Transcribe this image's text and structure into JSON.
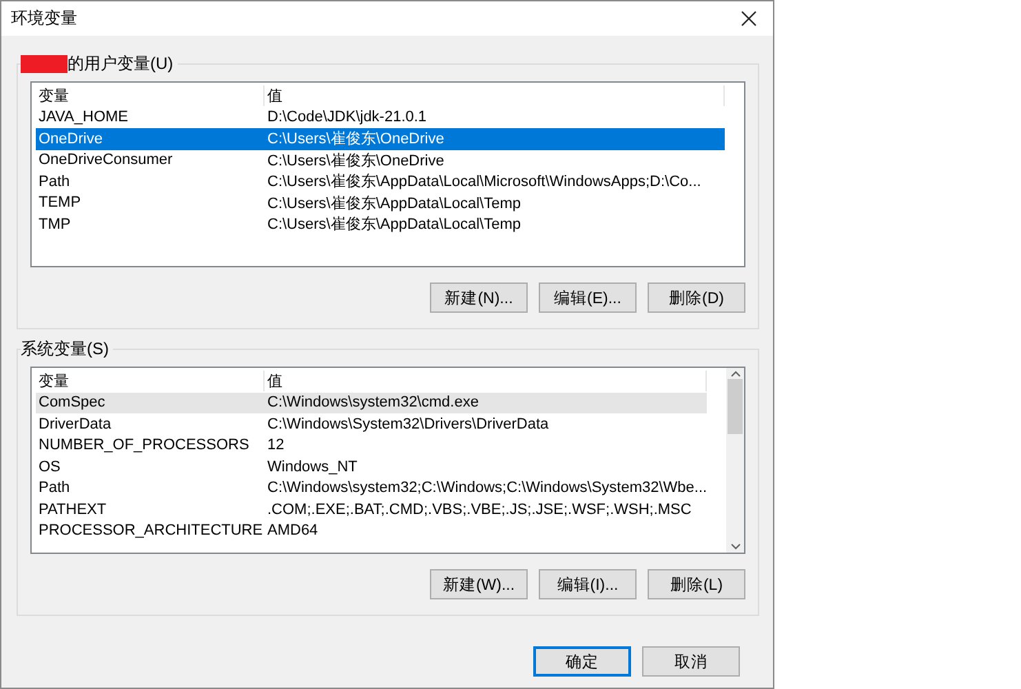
{
  "window": {
    "title": "环境变量"
  },
  "user_vars": {
    "legend": "的用户变量(U)",
    "focused": true,
    "columns": [
      "变量",
      "值"
    ],
    "rows": [
      {
        "name": "JAVA_HOME",
        "value": "D:\\Code\\JDK\\jdk-21.0.1",
        "selected": false
      },
      {
        "name": "OneDrive",
        "value": "C:\\Users\\崔俊东\\OneDrive",
        "selected": true
      },
      {
        "name": "OneDriveConsumer",
        "value": "C:\\Users\\崔俊东\\OneDrive",
        "selected": false
      },
      {
        "name": "Path",
        "value": "C:\\Users\\崔俊东\\AppData\\Local\\Microsoft\\WindowsApps;D:\\Co...",
        "selected": false
      },
      {
        "name": "TEMP",
        "value": "C:\\Users\\崔俊东\\AppData\\Local\\Temp",
        "selected": false
      },
      {
        "name": "TMP",
        "value": "C:\\Users\\崔俊东\\AppData\\Local\\Temp",
        "selected": false
      }
    ],
    "buttons": [
      "新建(N)...",
      "编辑(E)...",
      "删除(D)"
    ]
  },
  "system_vars": {
    "legend": "系统变量(S)",
    "focused": false,
    "columns": [
      "变量",
      "值"
    ],
    "rows": [
      {
        "name": "ComSpec",
        "value": "C:\\Windows\\system32\\cmd.exe",
        "selected": true
      },
      {
        "name": "DriverData",
        "value": "C:\\Windows\\System32\\Drivers\\DriverData",
        "selected": false
      },
      {
        "name": "NUMBER_OF_PROCESSORS",
        "value": "12",
        "selected": false
      },
      {
        "name": "OS",
        "value": "Windows_NT",
        "selected": false
      },
      {
        "name": "Path",
        "value": "C:\\Windows\\system32;C:\\Windows;C:\\Windows\\System32\\Wbe...",
        "selected": false
      },
      {
        "name": "PATHEXT",
        "value": ".COM;.EXE;.BAT;.CMD;.VBS;.VBE;.JS;.JSE;.WSF;.WSH;.MSC",
        "selected": false
      },
      {
        "name": "PROCESSOR_ARCHITECTURE",
        "value": "AMD64",
        "selected": false
      }
    ],
    "buttons": [
      "新建(W)...",
      "编辑(I)...",
      "删除(L)"
    ]
  },
  "footer_buttons": [
    {
      "label": "确定",
      "default": true
    },
    {
      "label": "取消",
      "default": false
    }
  ]
}
